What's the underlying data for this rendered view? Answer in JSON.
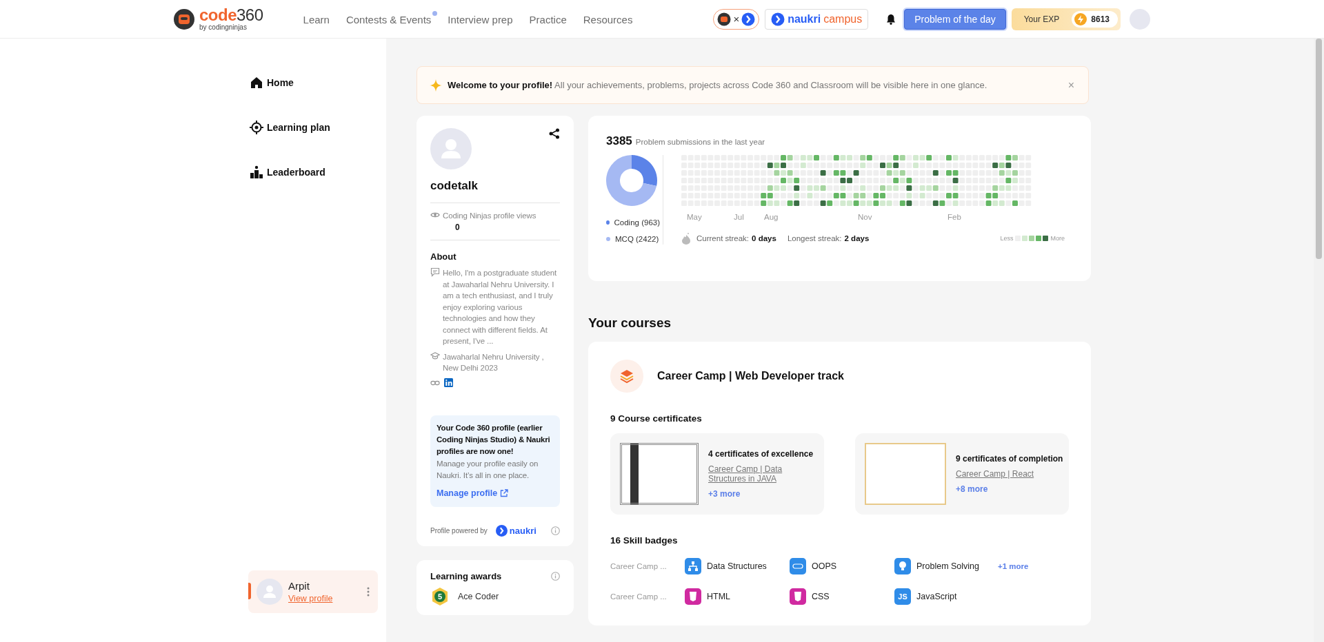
{
  "topbar": {
    "logo": {
      "word": "code",
      "number": "360",
      "byline": "by codingninjas"
    },
    "nav": [
      {
        "label": "Learn",
        "new": false
      },
      {
        "label": "Contests & Events",
        "new": true
      },
      {
        "label": "Interview prep",
        "new": false
      },
      {
        "label": "Practice",
        "new": false
      },
      {
        "label": "Resources",
        "new": false
      }
    ],
    "partner": {
      "separator": "×"
    },
    "campus": {
      "brand": "naukri",
      "word": "campus"
    },
    "potd_button": "Problem of the day",
    "exp": {
      "label": "Your EXP",
      "value": "8613"
    }
  },
  "sidebar": {
    "items": [
      {
        "label": "Home",
        "selected": false
      },
      {
        "label": "Learning plan",
        "selected": false
      },
      {
        "label": "Leaderboard",
        "selected": false
      }
    ],
    "user": {
      "name": "Arpit",
      "link": "View profile"
    }
  },
  "banner": {
    "text": "**Welcome to your profile!** All your achievements, problems, projects across Code 360 and Classroom will be visible here in one glance.",
    "close": "×"
  },
  "profile": {
    "username": "codetalk",
    "views_label": "Coding Ninjas profile views",
    "views": "0",
    "about_heading": "About",
    "bio": "Hello, I'm a postgraduate student at Jawaharlal Nehru University. I am a tech enthusiast, and I truly enjoy exploring various technologies and how they connect with different fields. At present, I've ...",
    "education": "Jawaharlal Nehru University , New Delhi 2023",
    "notice": {
      "title": "Your Code 360 profile (earlier Coding Ninjas Studio) & Naukri profiles are now one!",
      "body": "Manage your profile easily on Naukri. It’s all in one place.",
      "link": "Manage profile"
    },
    "powered_by": "Profile powered by",
    "powered_brand": "naukri"
  },
  "awards": {
    "heading": "Learning awards",
    "items": [
      {
        "name": "Ace Coder",
        "badge_number": "5"
      }
    ]
  },
  "activity": {
    "total": "3385",
    "caption": "Problem submissions in the last year",
    "chart_data": {
      "type": "donut",
      "categories": [
        "Coding (963)",
        "MCQ (2422)"
      ],
      "values": [
        963,
        2422
      ]
    },
    "legend": [
      {
        "color": "#5b83e8"
      },
      {
        "color": "#a5b9f3"
      }
    ],
    "months": [
      "May",
      "Jul",
      "Aug",
      "Nov",
      "Feb"
    ],
    "streaks": [
      {
        "label": "Current streak:",
        "value": "0 days"
      },
      {
        "label": "Longest streak:",
        "value": "2 days"
      }
    ],
    "scale": {
      "less": "Less",
      "more": "More"
    }
  },
  "courses": {
    "heading": "Your courses",
    "items": [
      {
        "title": "Career Camp | Web Developer track",
        "certificates_heading": "9 Course certificates",
        "certificates": [
          {
            "kind": "excellence",
            "title": "4 certificates of excellence",
            "link": "Career Camp | Data Structures in JAVA",
            "more": "+3 more"
          },
          {
            "kind": "completion",
            "title": "9 certificates of completion",
            "link": "Career Camp | React",
            "more": "+8 more"
          }
        ],
        "badges_heading": "16 Skill badges",
        "badge_rows": [
          {
            "course": "Career Camp ...",
            "badges": [
              {
                "kind": "structure",
                "label": "Data Structures"
              },
              {
                "kind": "oops",
                "label": "OOPS"
              },
              {
                "kind": "bulb",
                "label": "Problem Solving"
              }
            ],
            "more": "+1 more"
          },
          {
            "course": "Career Camp ...",
            "badges": [
              {
                "kind": "html",
                "label": "HTML"
              },
              {
                "kind": "css",
                "label": "CSS"
              },
              {
                "kind": "js",
                "label": "JavaScript",
                "icon_text": "JS"
              }
            ]
          }
        ]
      }
    ]
  }
}
